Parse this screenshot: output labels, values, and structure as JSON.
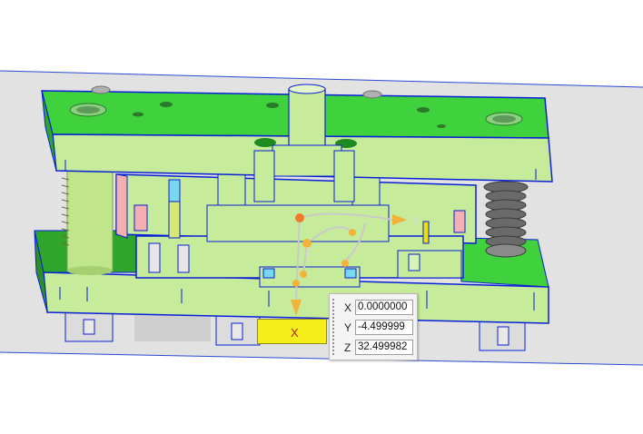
{
  "viewport": {
    "colors": {
      "background": "#ffffff",
      "ground": "#e2e2e2",
      "plate_green": "#3fd23c",
      "plate_light": "#c6eb9a",
      "edge_blue": "#0a1fd8",
      "spring_dark": "#6a6a6a",
      "pin_yellow": "#f0e000",
      "handle_orange": "#f2b33a"
    },
    "axis_labels": {
      "y": "Y",
      "z": "Z"
    }
  },
  "x_axis_indicator": {
    "label": "X"
  },
  "coordinate_panel": {
    "rows": [
      {
        "label": "X",
        "value": "0.0000000"
      },
      {
        "label": "Y",
        "value": "-4.499999"
      },
      {
        "label": "Z",
        "value": "32.499982"
      }
    ]
  }
}
